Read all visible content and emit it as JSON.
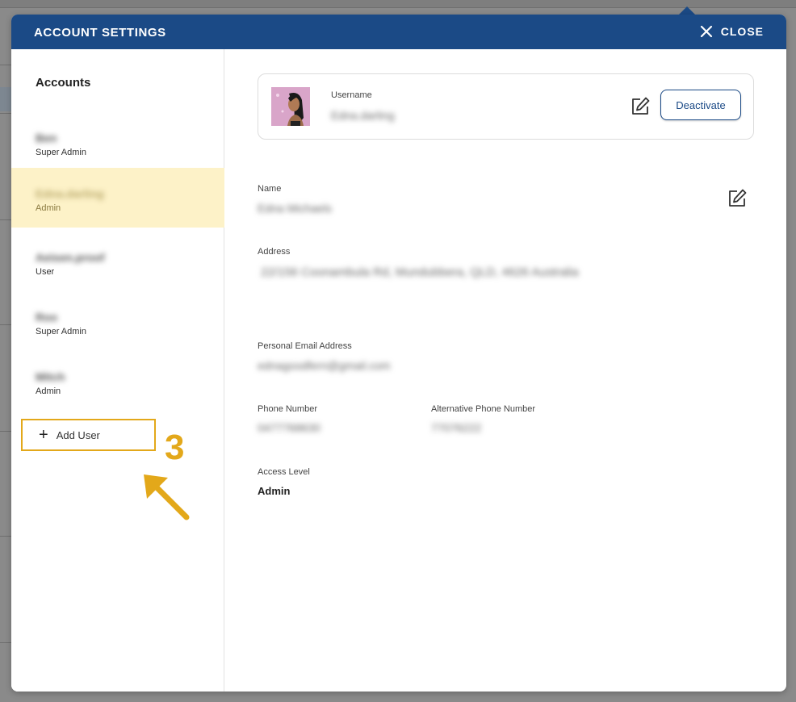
{
  "modal": {
    "title": "ACCOUNT SETTINGS",
    "close_label": "CLOSE",
    "header_color": "#1b4a86"
  },
  "sidebar": {
    "title": "Accounts",
    "accounts": [
      {
        "name": "Ben",
        "role": "Super Admin"
      },
      {
        "name": "Edna.darling",
        "role": "Admin",
        "selected": true
      },
      {
        "name": "Aeisen.proof",
        "role": "User"
      },
      {
        "name": "Roo",
        "role": "Super Admin"
      },
      {
        "name": "Mitch",
        "role": "Admin"
      }
    ],
    "add_user_label": "Add User"
  },
  "annotation": {
    "step_number": "3",
    "color": "#e3a81a"
  },
  "profile": {
    "username_label": "Username",
    "username_value": "Edna.darling",
    "deactivate_label": "Deactivate",
    "name_label": "Name",
    "name_value": "Edna Michaels",
    "address_label": "Address",
    "address_value": "22/156 Coonambula Rd, Mundubbera, QLD, 4626 Australia",
    "email_label": "Personal Email Address",
    "email_value": "ednagoodfern@gmail.com",
    "phone_label": "Phone Number",
    "phone_value": "0477768630",
    "alt_phone_label": "Alternative Phone Number",
    "alt_phone_value": "77076222",
    "access_label": "Access Level",
    "access_value": "Admin"
  }
}
